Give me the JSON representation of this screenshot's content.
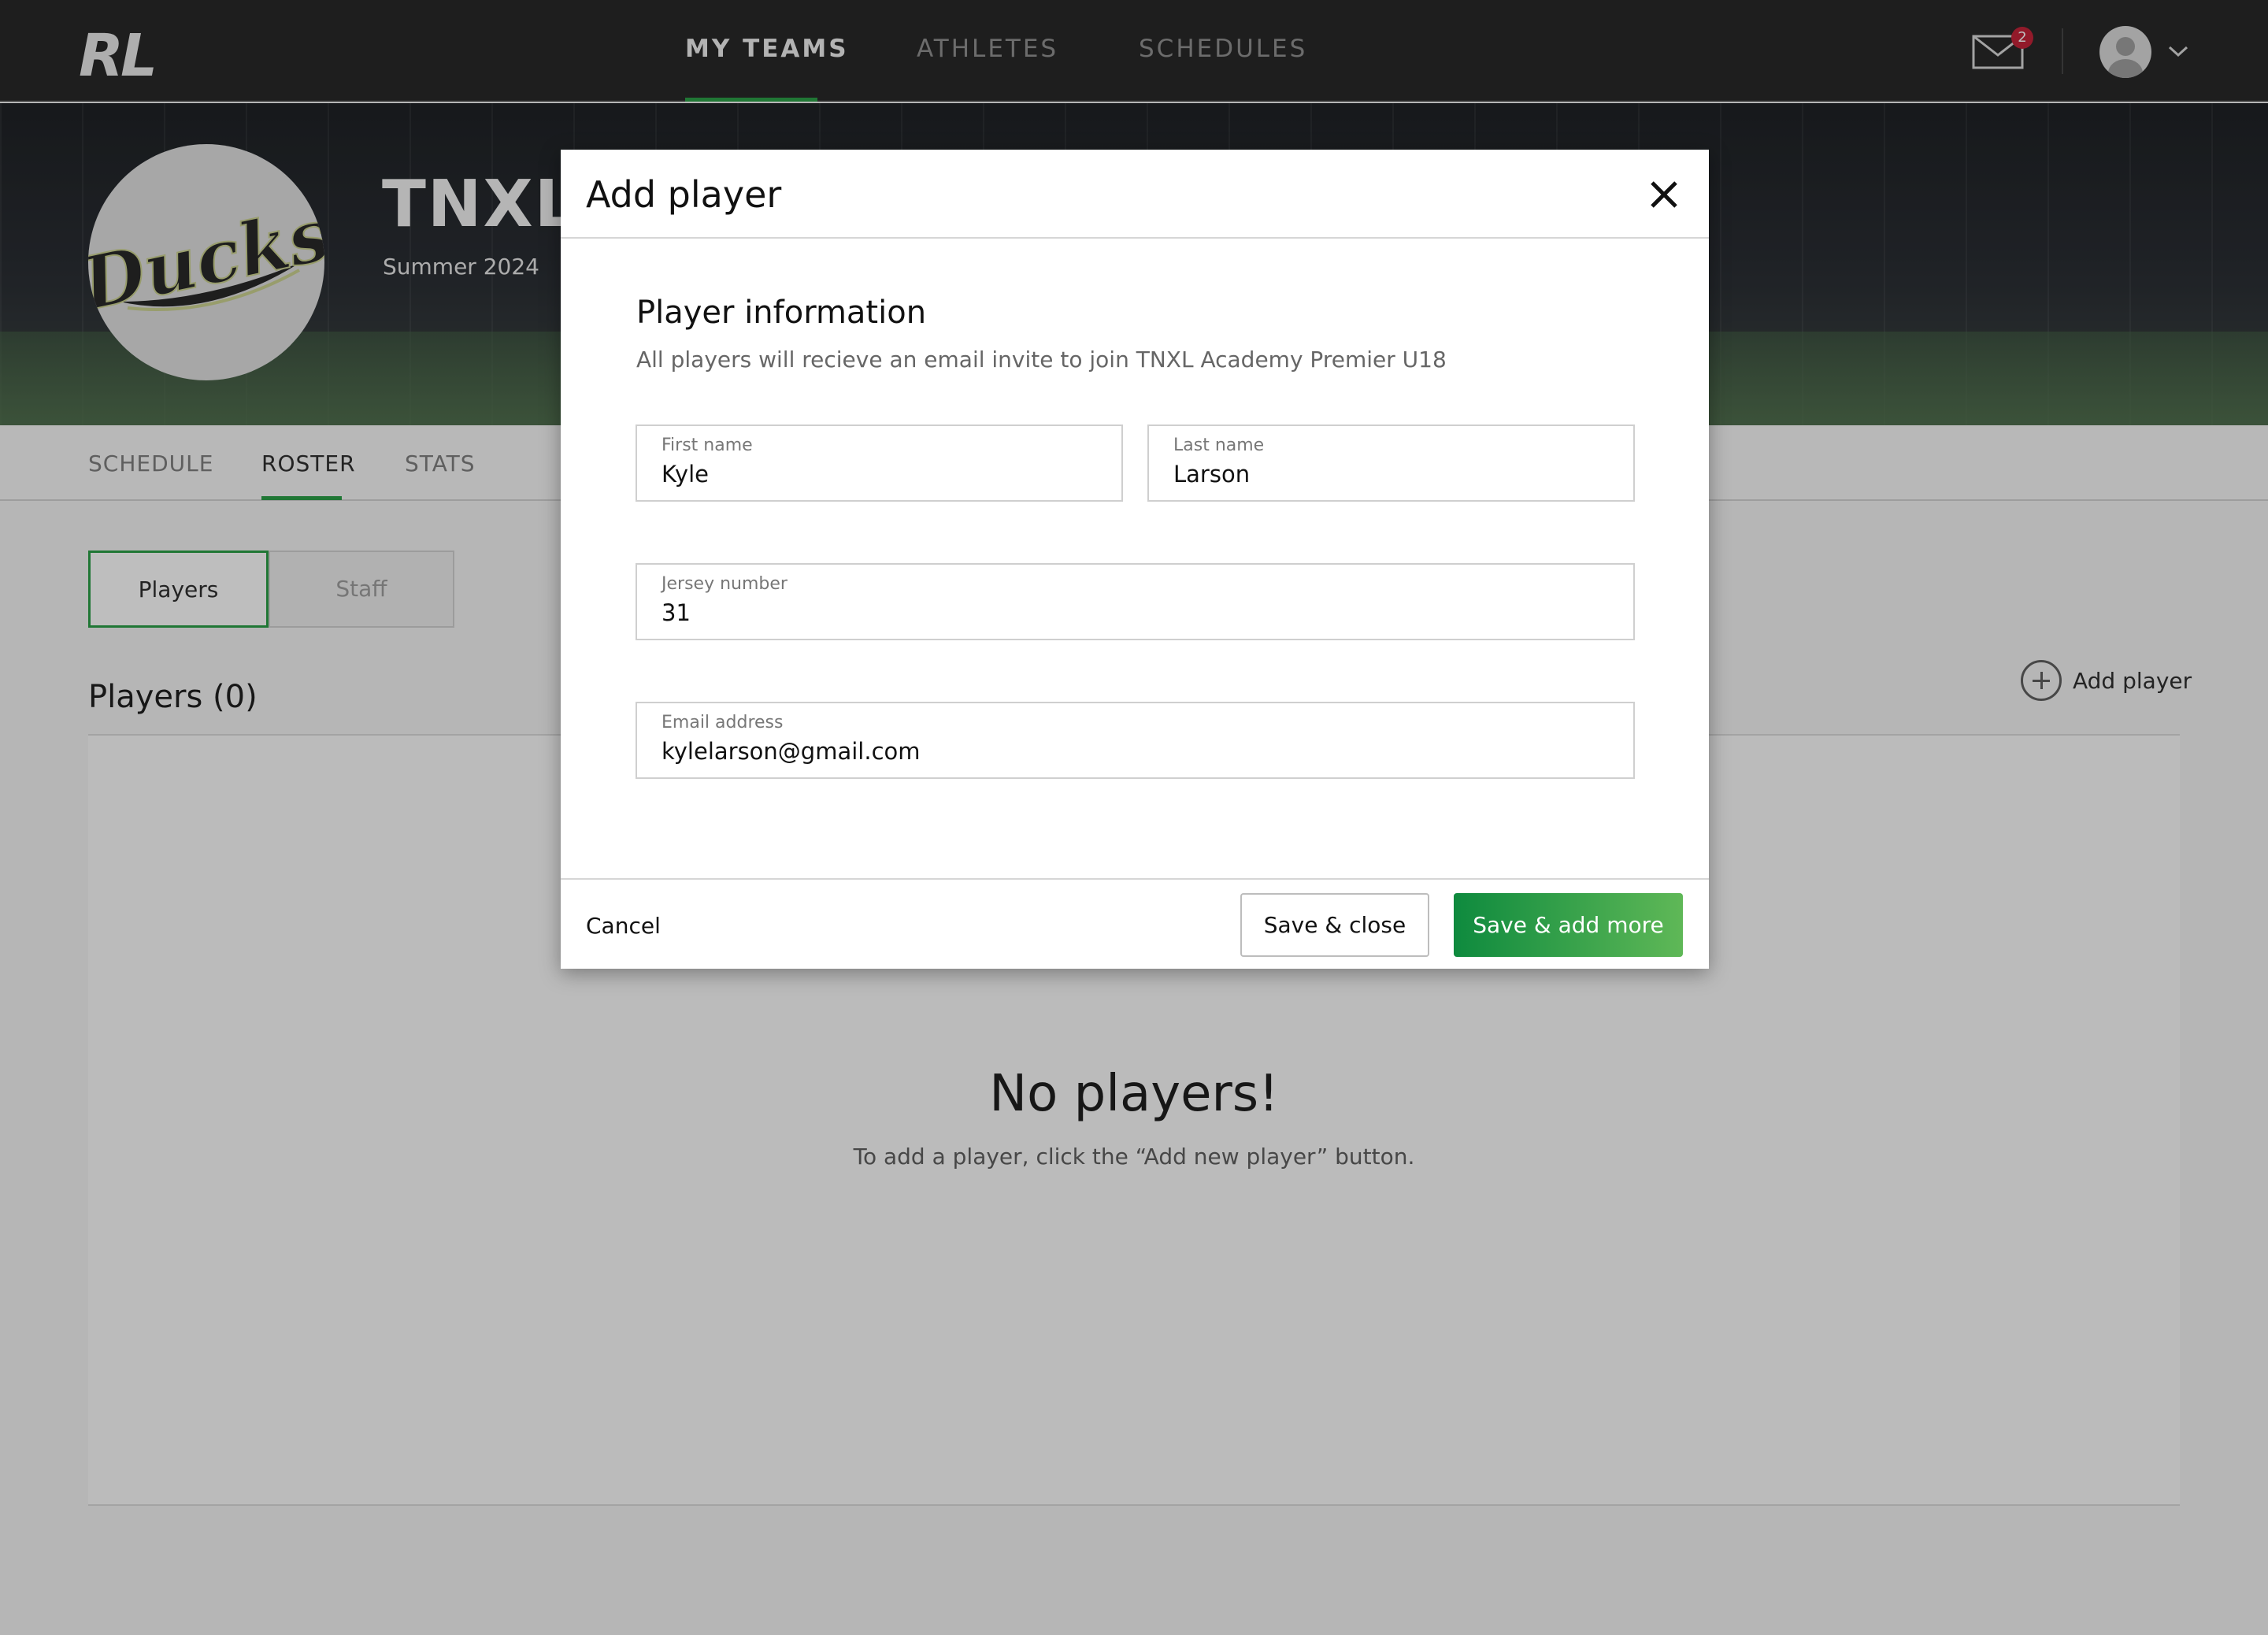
{
  "app": {
    "logo_text": "RL"
  },
  "nav": {
    "items": [
      {
        "label": "MY TEAMS",
        "active": true
      },
      {
        "label": "ATHLETES",
        "active": false
      },
      {
        "label": "SCHEDULES",
        "active": false
      }
    ],
    "notifications_count": "2"
  },
  "team": {
    "logo_text": "Ducks",
    "name": "TNXL",
    "season": "Summer 2024"
  },
  "tabs": [
    {
      "label": "SCHEDULE",
      "active": false
    },
    {
      "label": "ROSTER",
      "active": true
    },
    {
      "label": "STATS",
      "active": false
    }
  ],
  "roster": {
    "segments": {
      "players": "Players",
      "staff": "Staff"
    },
    "heading": "Players (0)",
    "add_player_label": "Add player",
    "empty_title": "No players!",
    "empty_subtitle": "To add a player, click the “Add new player” button."
  },
  "modal": {
    "title": "Add player",
    "section_title": "Player information",
    "section_subtitle": "All players will recieve an email invite to join TNXL Academy Premier U18",
    "fields": {
      "first_name": {
        "label": "First name",
        "value": "Kyle"
      },
      "last_name": {
        "label": "Last name",
        "value": "Larson"
      },
      "jersey": {
        "label": "Jersey number",
        "value": "31"
      },
      "email": {
        "label": "Email address",
        "value": "kylelarson@gmail.com"
      }
    },
    "buttons": {
      "cancel": "Cancel",
      "save_close": "Save & close",
      "save_more": "Save & add more"
    }
  },
  "colors": {
    "accent_green": "#1e9a3c",
    "badge_red": "#c0152b",
    "topbar": "#1b1b1b"
  },
  "icons": [
    "mail-icon",
    "avatar-icon",
    "chevron-down-icon",
    "plus-circle-icon",
    "close-icon"
  ]
}
